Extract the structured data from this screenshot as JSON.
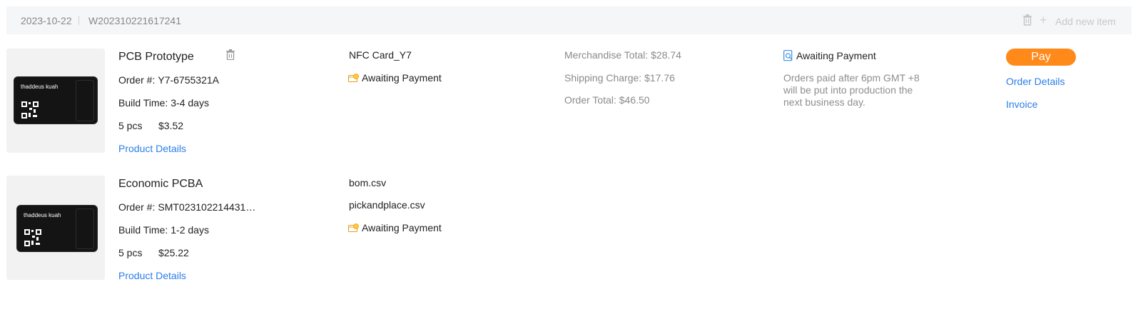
{
  "header": {
    "date": "2023-10-22",
    "order_number": "W202310221617241",
    "add_label": "Add new item"
  },
  "items": [
    {
      "title": "PCB Prototype",
      "order_label": "Order #:",
      "order_value": "Y7-6755321A",
      "build_label": "Build Time:",
      "build_value": "3-4 days",
      "qty": "5 pcs",
      "price": "$3.52",
      "details_link": "Product Details",
      "file_name": "NFC Card_Y7",
      "file_status": "Awaiting Payment",
      "card_name": "thaddeus kuah"
    },
    {
      "title": "Economic PCBA",
      "order_label": "Order #:",
      "order_value": "SMT023102214431…",
      "build_label": "Build Time:",
      "build_value": "1-2 days",
      "qty": "5 pcs",
      "price": "$25.22",
      "details_link": "Product Details",
      "file_1": "bom.csv",
      "file_2": "pickandplace.csv",
      "file_status": "Awaiting Payment",
      "card_name": "thaddeus kuah"
    }
  ],
  "totals": {
    "merchandise": "Merchandise Total: $28.74",
    "shipping": "Shipping Charge: $17.76",
    "order_total": "Order Total: $46.50"
  },
  "order_status": {
    "label": "Awaiting Payment",
    "note": "Orders paid after 6pm GMT +8 will be put into production the next business day."
  },
  "actions": {
    "pay": "Pay",
    "order_details": "Order Details",
    "invoice": "Invoice"
  },
  "colors": {
    "accent": "#ff8a1a",
    "link": "#2a7ee8",
    "header_bg": "#f5f6f7"
  }
}
